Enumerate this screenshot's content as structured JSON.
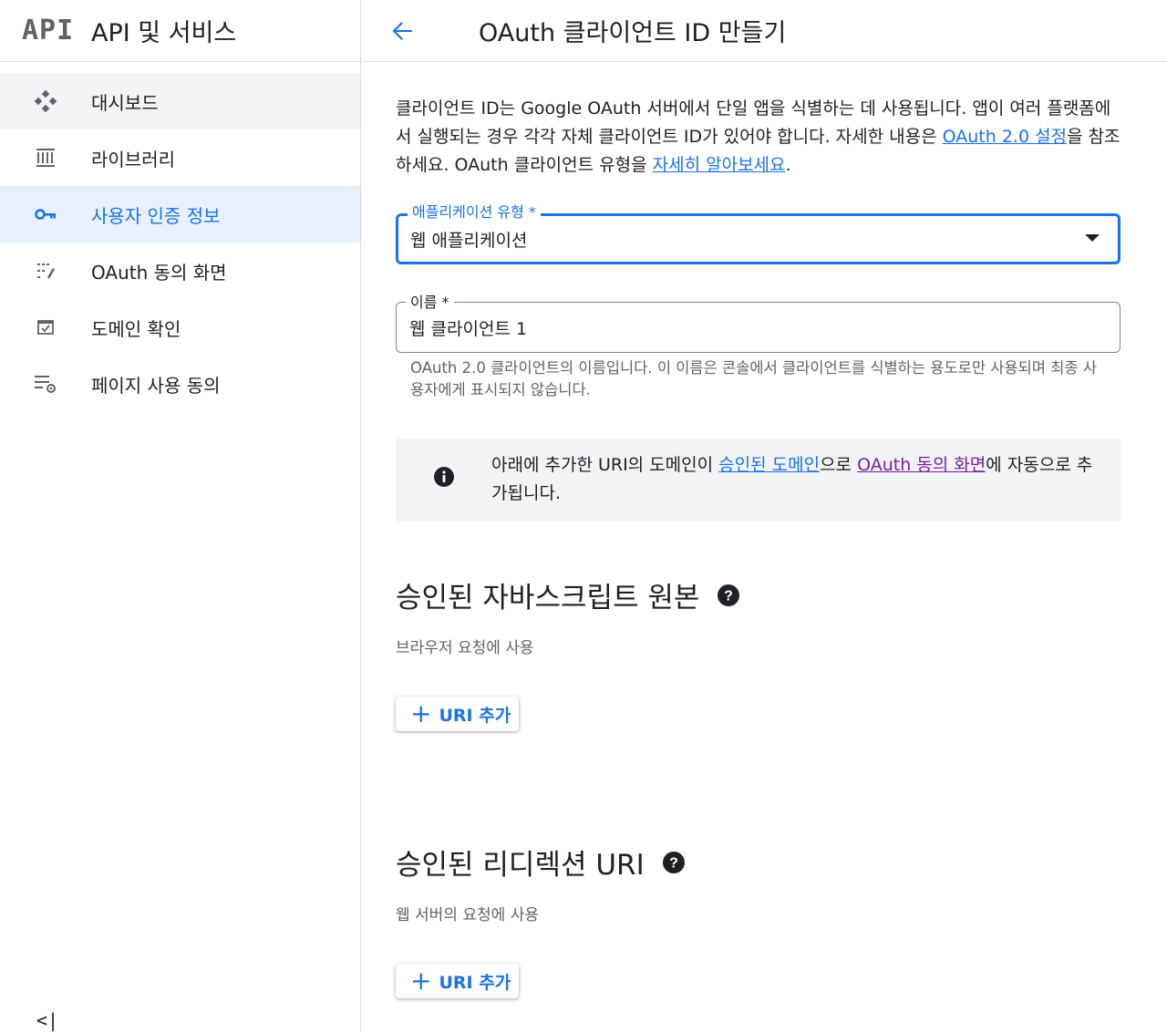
{
  "sidebar": {
    "logo": "API",
    "title": "API 및 서비스",
    "items": [
      {
        "label": "대시보드",
        "icon": "dashboard-icon"
      },
      {
        "label": "라이브러리",
        "icon": "library-icon"
      },
      {
        "label": "사용자 인증 정보",
        "icon": "key-icon"
      },
      {
        "label": "OAuth 동의 화면",
        "icon": "consent-screen-icon"
      },
      {
        "label": "도메인 확인",
        "icon": "domain-verification-icon"
      },
      {
        "label": "페이지 사용 동의",
        "icon": "page-usage-agreement-icon"
      }
    ],
    "collapse": "<|"
  },
  "header": {
    "title": "OAuth 클라이언트 ID 만들기"
  },
  "description": {
    "part1": "클라이언트 ID는 Google OAuth 서버에서 단일 앱을 식별하는 데 사용됩니다. 앱이 여러 플랫폼에서 실행되는 경우 각각 자체 클라이언트 ID가 있어야 합니다. 자세한 내용은 ",
    "link1": "OAuth 2.0 설정",
    "part2": "을 참조하세요. OAuth 클라이언트 유형을 ",
    "link2": "자세히 알아보세요",
    "part3": "."
  },
  "app_type": {
    "label": "애플리케이션 유형 *",
    "value": "웹 애플리케이션"
  },
  "name_field": {
    "label": "이름 *",
    "value": "웹 클라이언트 1",
    "hint": "OAuth 2.0 클라이언트의 이름입니다. 이 이름은 콘솔에서 클라이언트를 식별하는 용도로만 사용되며 최종 사용자에게 표시되지 않습니다."
  },
  "info_box": {
    "part1": "아래에 추가한 URI의 도메인이 ",
    "link1": "승인된 도메인",
    "part2": "으로 ",
    "link2": "OAuth 동의 화면",
    "part3": "에 자동으로 추가됩니다."
  },
  "js_origins": {
    "title": "승인된 자바스크립트 원본",
    "subtitle": "브라우저 요청에 사용",
    "button": "URI 추가"
  },
  "redirect_uris": {
    "title": "승인된 리디렉션 URI",
    "subtitle": "웹 서버의 요청에 사용",
    "button": "URI 추가"
  },
  "colors": {
    "accent": "#1a73e8",
    "visited_link": "#7b1fa2",
    "active_bg": "#e8f0fe"
  }
}
